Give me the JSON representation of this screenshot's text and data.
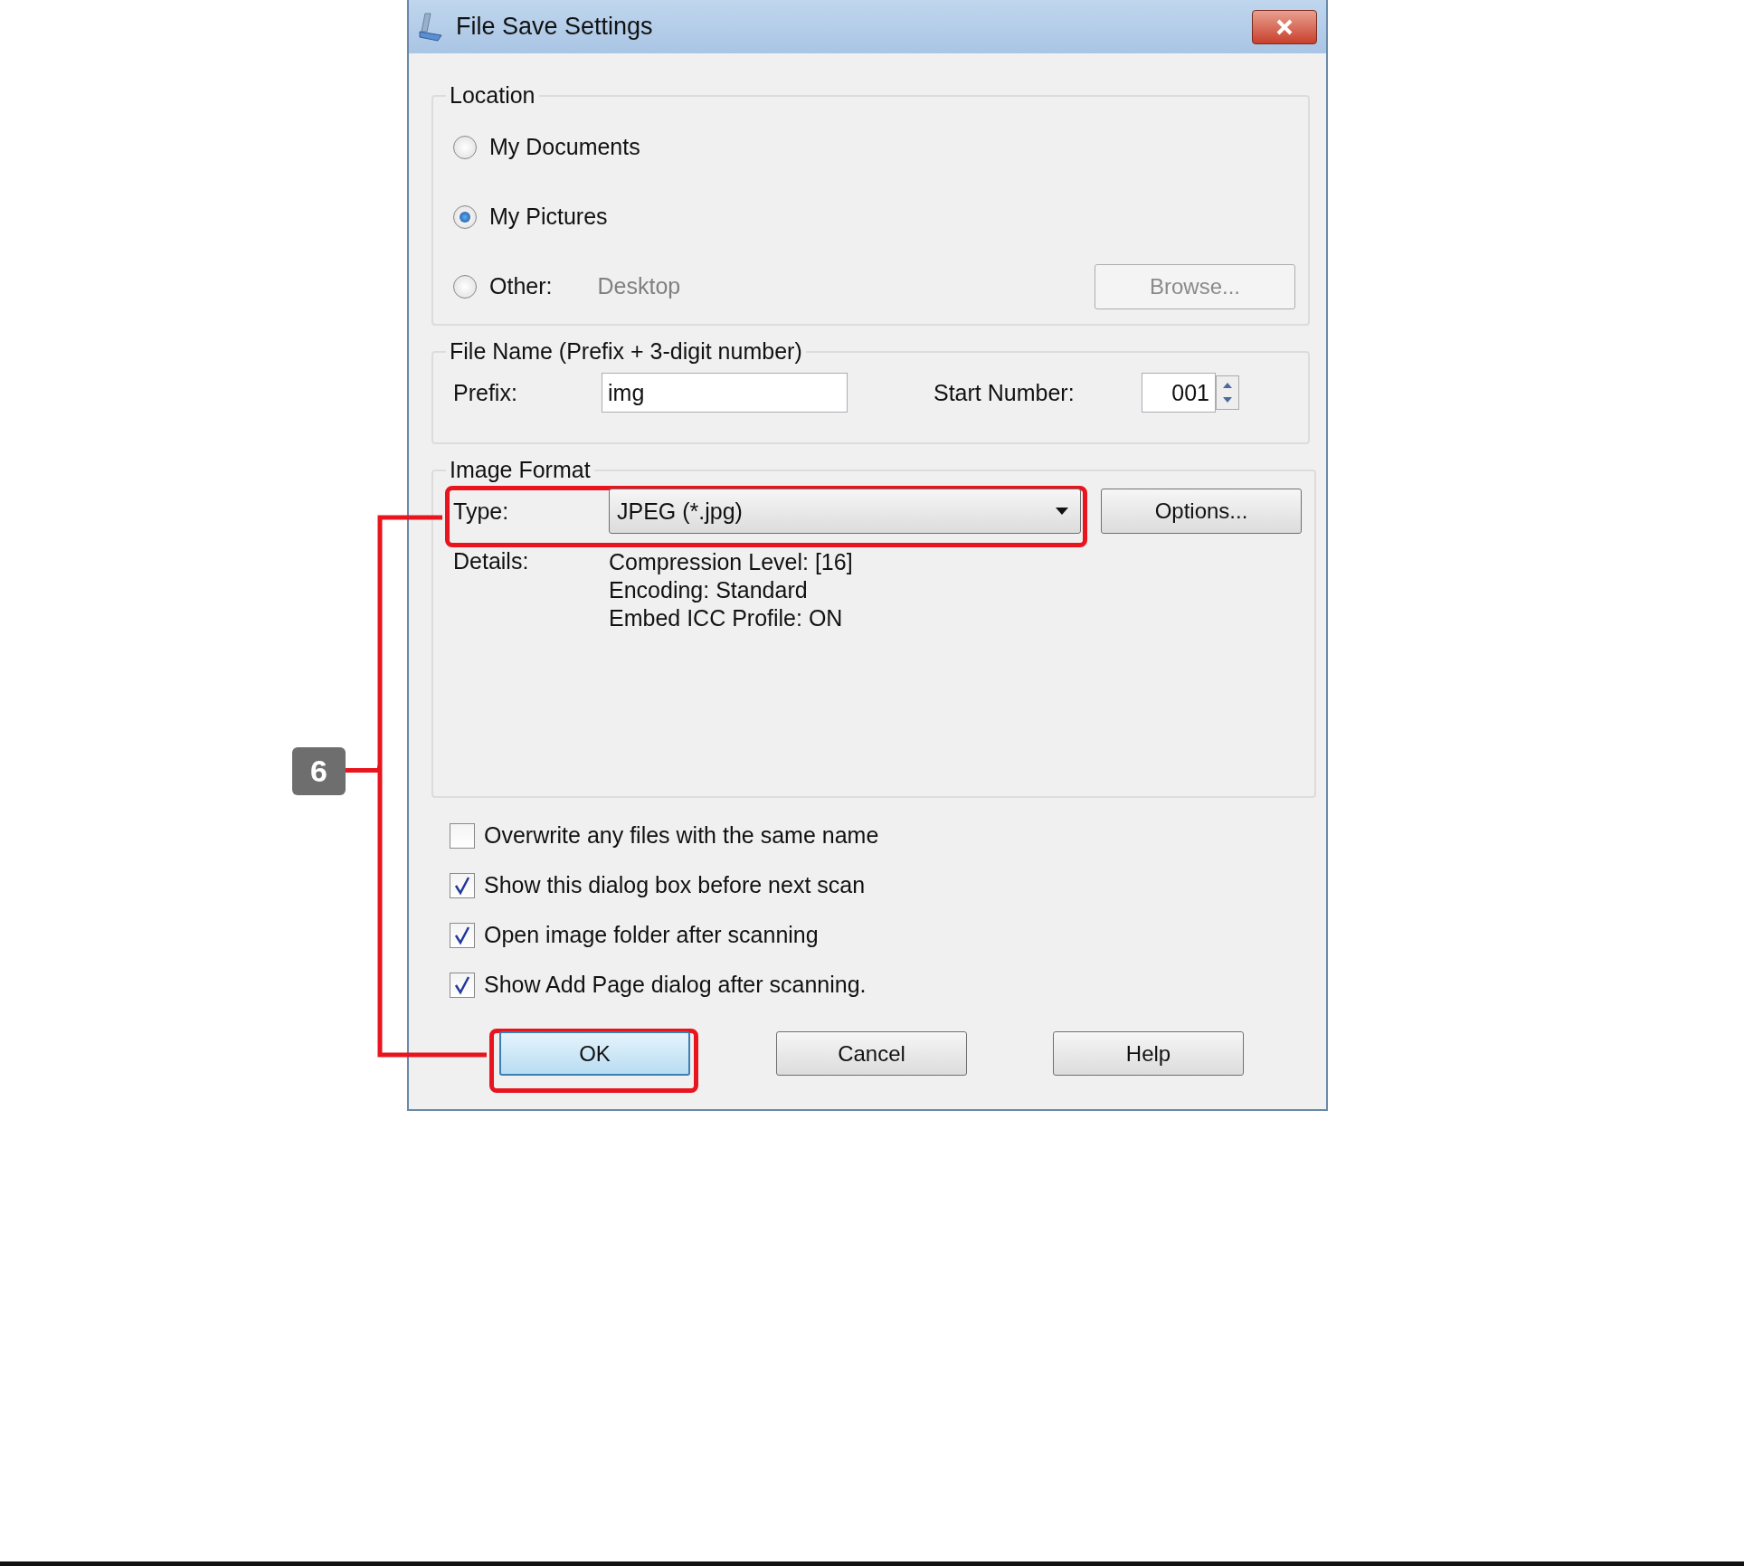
{
  "window": {
    "title": "File Save Settings"
  },
  "location": {
    "legend": "Location",
    "options": [
      {
        "label": "My Documents",
        "selected": false
      },
      {
        "label": "My Pictures",
        "selected": true
      },
      {
        "label": "Other:",
        "selected": false,
        "value": "Desktop"
      }
    ],
    "browse_button": {
      "label": "Browse...",
      "disabled": true
    }
  },
  "file_name": {
    "legend": "File Name (Prefix + 3-digit number)",
    "prefix_label": "Prefix:",
    "prefix": "img",
    "start_number_label": "Start Number:",
    "start_number": "001"
  },
  "image_format": {
    "legend": "Image Format",
    "type_label": "Type:",
    "type": "JPEG (*.jpg)",
    "options_button": "Options...",
    "details_label": "Details:",
    "details": [
      "Compression Level: [16]",
      "Encoding: Standard",
      "Embed ICC Profile: ON"
    ]
  },
  "checkboxes": [
    {
      "label": "Overwrite any files with the same name",
      "checked": false
    },
    {
      "label": "Show this dialog box before next scan",
      "checked": true
    },
    {
      "label": "Open image folder after scanning",
      "checked": true
    },
    {
      "label": "Show Add Page dialog after scanning.",
      "checked": true
    }
  ],
  "buttons": [
    {
      "label": "OK",
      "default": true
    },
    {
      "label": "Cancel",
      "default": false
    },
    {
      "label": "Help",
      "default": false
    }
  ],
  "callout": {
    "number": "6"
  }
}
